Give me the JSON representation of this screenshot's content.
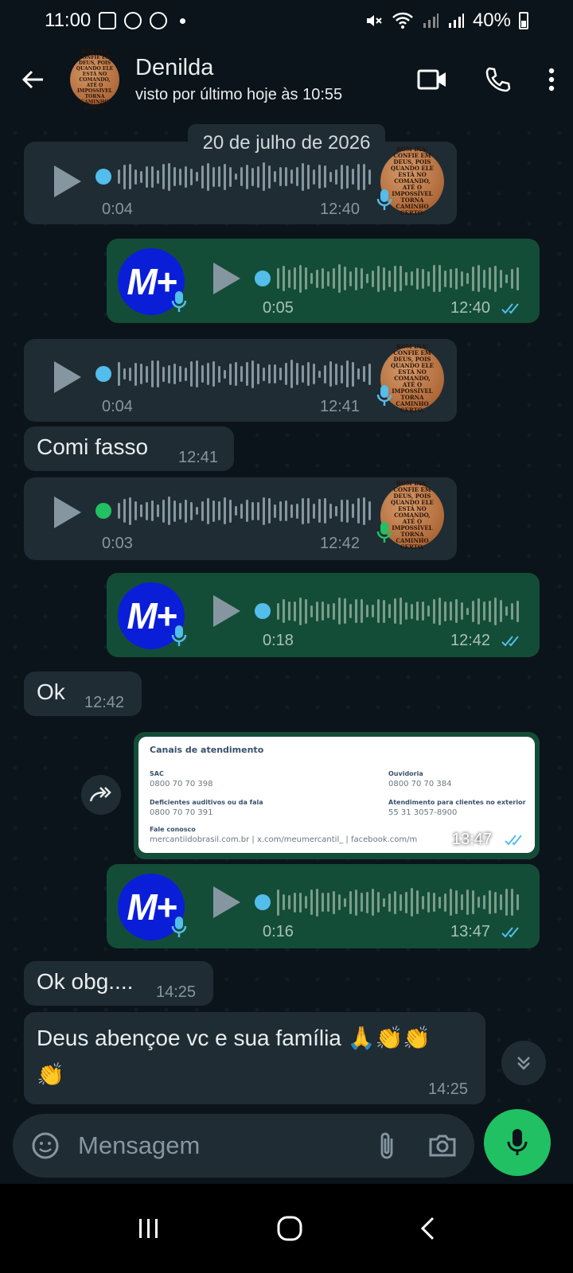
{
  "status_bar": {
    "time": "11:00",
    "battery": "40%",
    "icons": [
      "gallery-icon",
      "whatsapp-business-icon",
      "whatsapp-icon",
      "mute-icon",
      "wifi-icon",
      "signal-icon",
      "battery-icon"
    ]
  },
  "header": {
    "contact_name": "Denilda",
    "last_seen": "visto por último hoje às 10:55",
    "avatar_text": "BOM DIA! CONFIE EM DEUS, POIS QUANDO ELE ESTÁ NO COMANDO, ATÉ O IMPOSSÍVEL TORNA CAMINHO CERTO."
  },
  "date_chip": "20 de julho de 2026",
  "messages": [
    {
      "id": "m1",
      "type": "audio",
      "direction": "in",
      "duration": "0:04",
      "time": "12:40",
      "played": true
    },
    {
      "id": "m2",
      "type": "audio",
      "direction": "out",
      "duration": "0:05",
      "time": "12:40",
      "avatar": "M+",
      "status": "read"
    },
    {
      "id": "m3",
      "type": "audio",
      "direction": "in",
      "duration": "0:04",
      "time": "12:41",
      "played": true
    },
    {
      "id": "m4",
      "type": "text",
      "direction": "in",
      "text": "Comi fasso",
      "time": "12:41"
    },
    {
      "id": "m5",
      "type": "audio",
      "direction": "in",
      "duration": "0:03",
      "time": "12:42",
      "played": false
    },
    {
      "id": "m6",
      "type": "audio",
      "direction": "out",
      "duration": "0:18",
      "time": "12:42",
      "avatar": "M+",
      "status": "read"
    },
    {
      "id": "m7",
      "type": "text",
      "direction": "in",
      "text": "Ok",
      "time": "12:42"
    },
    {
      "id": "m8",
      "type": "image",
      "direction": "out",
      "time": "13:47",
      "status": "read",
      "card": {
        "title": "Canais de atendimento",
        "sac_label": "SAC",
        "sac_value": "0800 70 70 398",
        "ouvidoria_label": "Ouvidoria",
        "ouvidoria_value": "0800 70 70 384",
        "deficientes_label": "Deficientes auditivos ou da fala",
        "deficientes_value": "0800 70 70 391",
        "exterior_label": "Atendimento para clientes no exterior",
        "exterior_value": "55 31 3057-8900",
        "fale_label": "Fale conosco",
        "fale_value": "mercantildobrasil.com.br | x.com/meumercantil_ | facebook.com/m"
      }
    },
    {
      "id": "m9",
      "type": "audio",
      "direction": "out",
      "duration": "0:16",
      "time": "13:47",
      "avatar": "M+",
      "status": "read"
    },
    {
      "id": "m10",
      "type": "text",
      "direction": "in",
      "text": "Ok obg....",
      "time": "14:25"
    },
    {
      "id": "m11",
      "type": "text",
      "direction": "in",
      "text": "Deus abençoe vc e sua família 🙏👏👏",
      "text_line2": "👏",
      "time": "14:25"
    }
  ],
  "input": {
    "placeholder": "Mensagem"
  },
  "colors": {
    "background": "#0b141a",
    "incoming_bubble": "#1f2c34",
    "outgoing_bubble": "#144d37",
    "accent_green": "#21c063",
    "read_ticks": "#53bdeb"
  }
}
